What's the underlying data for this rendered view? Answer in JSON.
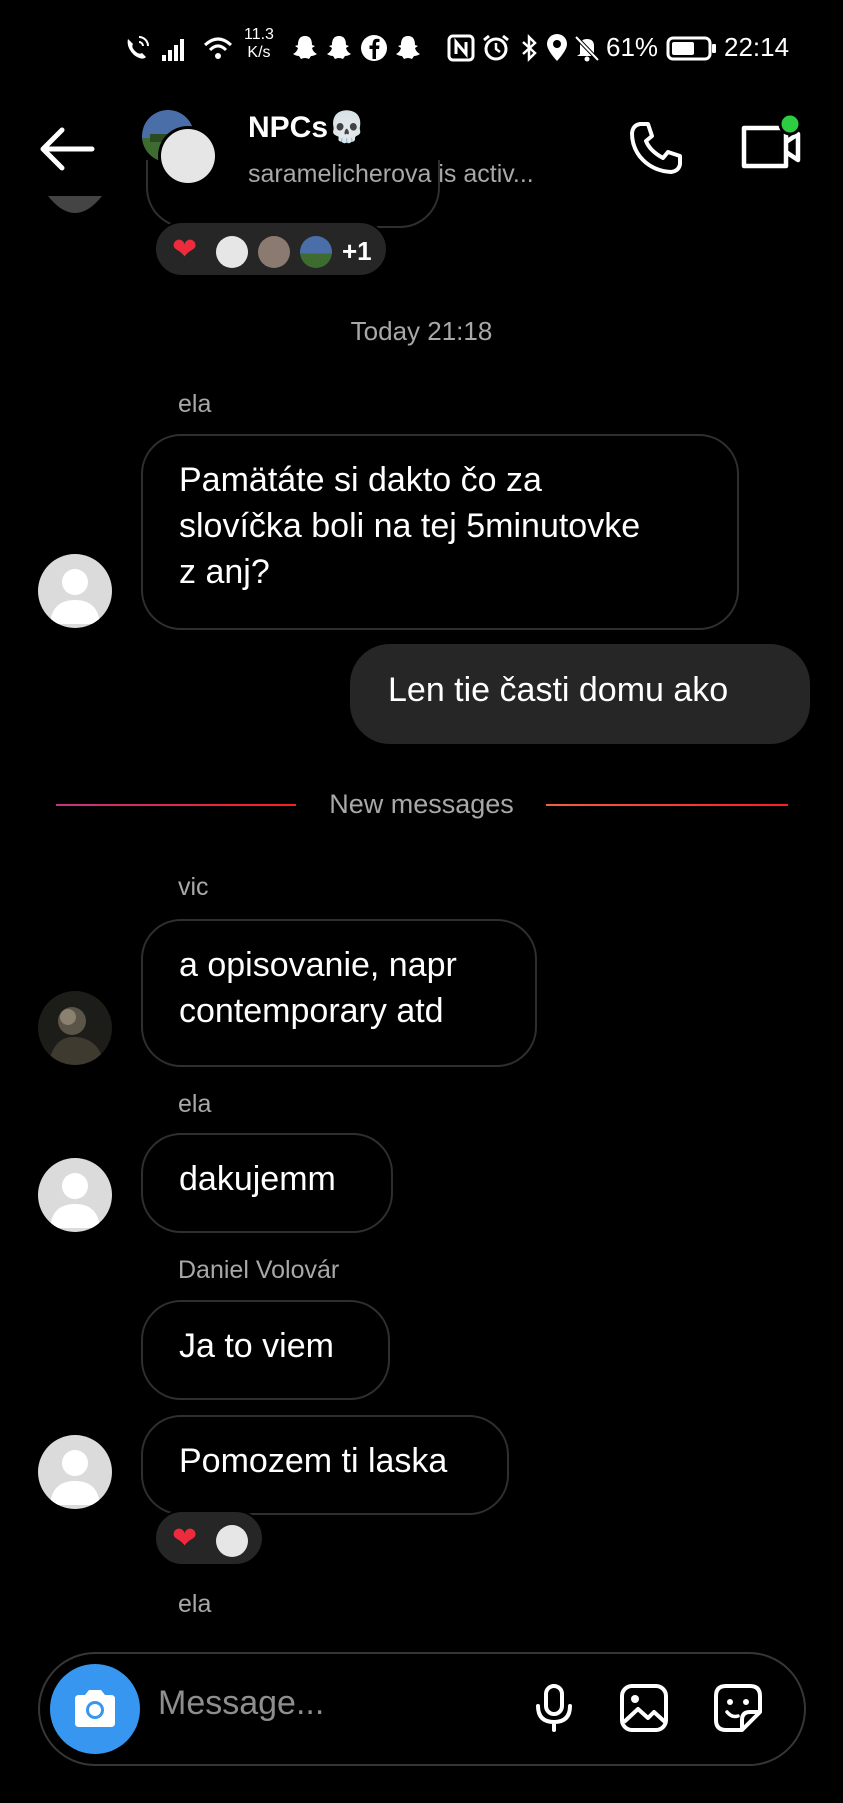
{
  "status_bar": {
    "speed_top": "11.3",
    "speed_unit": "K/s",
    "battery": "61%",
    "time": "22:14"
  },
  "header": {
    "title": "NPCs💀",
    "subtitle": "saramelicherova is activ..."
  },
  "top_reactions": {
    "extra_count": "+1"
  },
  "timestamp": "Today 21:18",
  "messages": [
    {
      "sender": "ela",
      "text_lines": [
        "Pamätáte si dakto čo za",
        "slovíčka boli na tej 5minutovke",
        "z anj?"
      ]
    },
    {
      "sender": "me",
      "text": "Len tie časti domu ako"
    },
    {
      "sender": "vic",
      "text_lines": [
        "a opisovanie, napr",
        "contemporary atd"
      ]
    },
    {
      "sender": "ela",
      "text": "dakujemm"
    },
    {
      "sender": "Daniel Volovár",
      "text": "Ja to viem"
    },
    {
      "sender": "",
      "text": "Pomozem ti laska"
    },
    {
      "sender": "ela",
      "text": ""
    }
  ],
  "divider": {
    "label": "New messages",
    "gradient_left": [
      "#c13584",
      "#fd1d1d"
    ],
    "gradient_right": [
      "#f56040",
      "#fd1d1d"
    ]
  },
  "composer": {
    "placeholder": "Message..."
  },
  "colors": {
    "accent_blue": "#3797f0",
    "online_green": "#2ecc40",
    "heart_red": "#ed2b3d"
  }
}
